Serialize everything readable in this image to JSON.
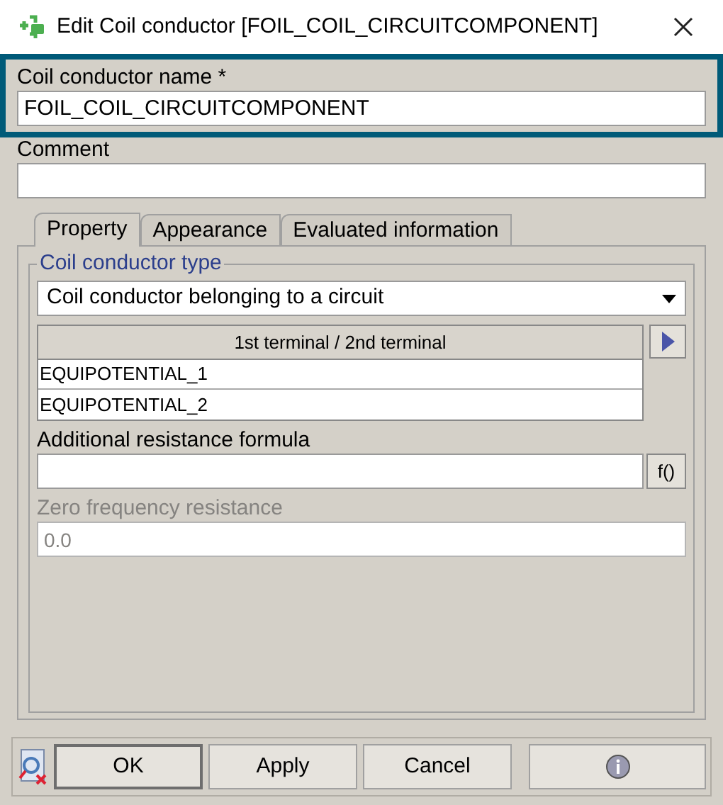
{
  "window": {
    "title": "Edit Coil conductor [FOIL_COIL_CIRCUITCOMPONENT]"
  },
  "name_field": {
    "label": "Coil conductor name *",
    "value": "FOIL_COIL_CIRCUITCOMPONENT",
    "highlighted": true
  },
  "comment_field": {
    "label": "Comment"
  },
  "tabs": [
    {
      "label": "Property",
      "selected": true
    },
    {
      "label": "Appearance",
      "selected": false
    },
    {
      "label": "Evaluated information",
      "selected": false
    }
  ],
  "type_group": {
    "title": "Coil conductor  type",
    "value": "Coil conductor belonging to a circuit"
  },
  "terminals": {
    "column": "1st terminal / 2nd terminal",
    "rows": [
      "EQUIPOTENTIAL_1",
      "EQUIPOTENTIAL_2"
    ]
  },
  "resistance_formula": {
    "label": "Additional resistance formula",
    "button": "f()"
  },
  "zero_frequency_resistance": {
    "label": "Zero frequency resistance",
    "value": "0.0",
    "disabled": true
  },
  "buttons": [
    {
      "label": "OK",
      "default": true
    },
    {
      "label": "Apply",
      "default": false
    },
    {
      "label": "Cancel",
      "default": false
    }
  ]
}
